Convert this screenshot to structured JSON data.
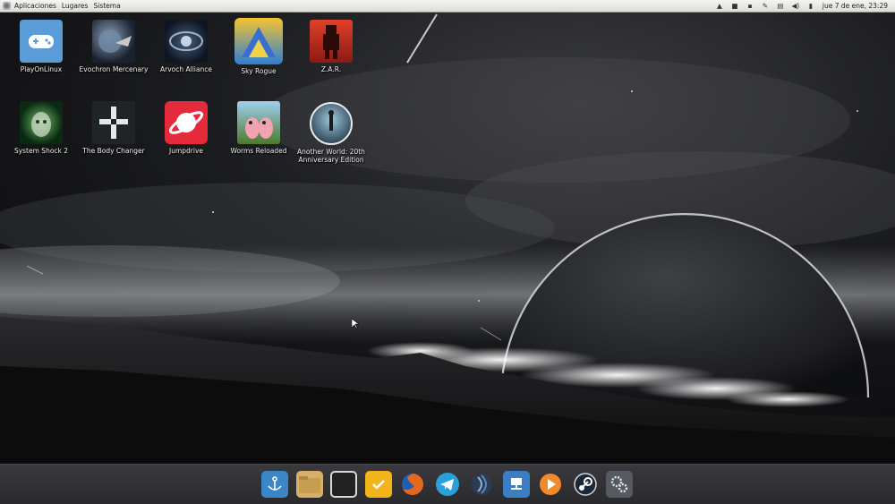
{
  "top_panel": {
    "menus": [
      "Aplicaciones",
      "Lugares",
      "Sistema"
    ],
    "clock": "jue 7 de ene, 23:29"
  },
  "desktop_icons": [
    {
      "label": "PlayOnLinux",
      "icon": "gamepad-icon"
    },
    {
      "label": "Evochron Mercenary",
      "icon": "planet-ship-icon"
    },
    {
      "label": "Arvoch Alliance",
      "icon": "space-station-icon"
    },
    {
      "label": "Sky Rogue",
      "icon": "sky-rogue-logo-icon"
    },
    {
      "label": "Z.A.R.",
      "icon": "zar-robot-icon"
    },
    {
      "label": "System Shock 2",
      "icon": "shodan-face-icon"
    },
    {
      "label": "The Body Changer",
      "icon": "cross-emblem-icon"
    },
    {
      "label": "Jumpdrive",
      "icon": "ringed-planet-icon"
    },
    {
      "label": "Worms Reloaded",
      "icon": "worms-icon"
    },
    {
      "label": "Another World: 20th Anniversary Edition",
      "icon": "another-world-icon"
    }
  ],
  "dock_items": [
    {
      "name": "anchor-app-icon",
      "color": "#3b86c6"
    },
    {
      "name": "files-folder-icon",
      "color": "#d6b06a"
    },
    {
      "name": "terminal-icon",
      "color": "#222222"
    },
    {
      "name": "tasks-icon",
      "color": "#f3b31a"
    },
    {
      "name": "firefox-icon",
      "color": "#e8671f"
    },
    {
      "name": "telegram-icon",
      "color": "#2aa0da"
    },
    {
      "name": "sound-waves-icon",
      "color": "#4c6fa2"
    },
    {
      "name": "network-icon",
      "color": "#3b7fc2"
    },
    {
      "name": "media-player-icon",
      "color": "#f08a2a"
    },
    {
      "name": "steam-icon",
      "color": "#1b2838"
    },
    {
      "name": "settings-gears-icon",
      "color": "#555a60"
    }
  ]
}
